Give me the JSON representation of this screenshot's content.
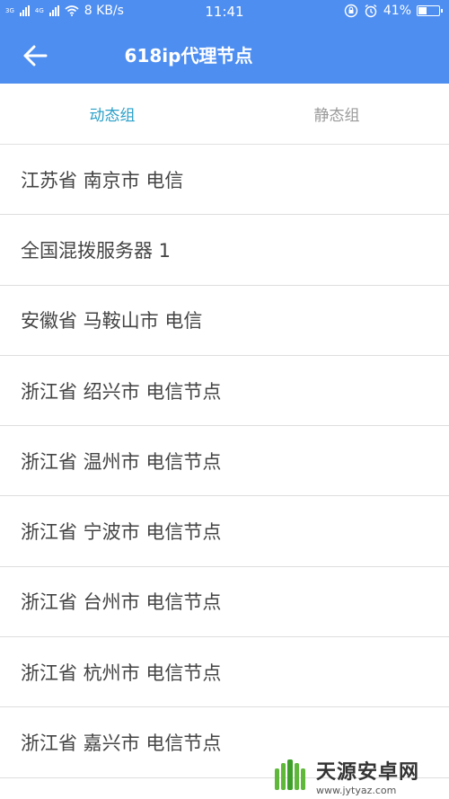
{
  "status_bar": {
    "network_label": "3G",
    "network_label_2": "4G",
    "speed": "8 KB/s",
    "time": "11:41",
    "battery": "41%",
    "battery_level": 0.41
  },
  "header": {
    "title": "618ip代理节点",
    "color": "#4e8ef0"
  },
  "tabs": [
    {
      "label": "动态组",
      "active": true
    },
    {
      "label": "静态组",
      "active": false
    }
  ],
  "nodes": [
    "江苏省 南京市 电信",
    "全国混拨服务器 1",
    "安徽省 马鞍山市 电信",
    "浙江省 绍兴市 电信节点",
    "浙江省 温州市 电信节点",
    "浙江省 宁波市 电信节点",
    "浙江省 台州市 电信节点",
    "浙江省 杭州市 电信节点",
    "浙江省 嘉兴市 电信节点"
  ],
  "watermark": {
    "name": "天源安卓网",
    "url": "www.jytyaz.com"
  }
}
